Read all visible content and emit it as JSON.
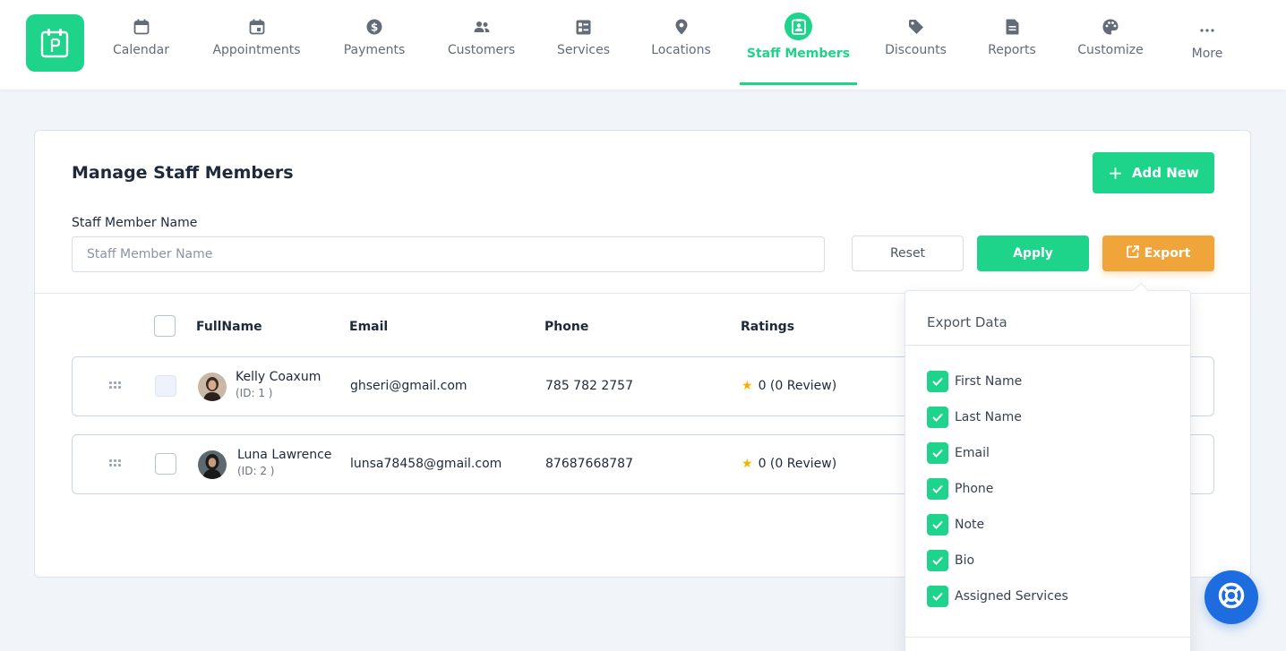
{
  "nav": {
    "logo_icon": "booking-logo-icon",
    "items": [
      {
        "label": "Calendar",
        "icon": "calendar-icon"
      },
      {
        "label": "Appointments",
        "icon": "appointment-icon"
      },
      {
        "label": "Payments",
        "icon": "dollar-icon"
      },
      {
        "label": "Customers",
        "icon": "users-icon"
      },
      {
        "label": "Services",
        "icon": "services-icon"
      },
      {
        "label": "Locations",
        "icon": "location-pin-icon"
      },
      {
        "label": "Staff Members",
        "icon": "staff-badge-icon",
        "active": true
      },
      {
        "label": "Discounts",
        "icon": "tag-icon"
      },
      {
        "label": "Reports",
        "icon": "report-icon"
      },
      {
        "label": "Customize",
        "icon": "palette-icon"
      },
      {
        "label": "More",
        "icon": "more-dots-icon"
      }
    ]
  },
  "page": {
    "title": "Manage Staff Members",
    "add_new_label": "Add New",
    "filter_label": "Staff Member Name",
    "filter_placeholder": "Staff Member Name",
    "filter_value": "",
    "reset_label": "Reset",
    "apply_label": "Apply",
    "export_label": "Export"
  },
  "table": {
    "headers": {
      "fullname": "FullName",
      "email": "Email",
      "phone": "Phone",
      "ratings": "Ratings"
    },
    "rows": [
      {
        "name": "Kelly Coaxum",
        "id": "(ID: 1 )",
        "email": "ghseri@gmail.com",
        "phone": "785 782 2757",
        "rating": "0 (0 Review)"
      },
      {
        "name": "Luna Lawrence",
        "id": "(ID: 2 )",
        "email": "lunsa78458@gmail.com",
        "phone": "87687668787",
        "rating": "0 (0 Review)"
      }
    ]
  },
  "export_menu": {
    "title": "Export Data",
    "options": [
      {
        "label": "First Name",
        "checked": true
      },
      {
        "label": "Last Name",
        "checked": true
      },
      {
        "label": "Email",
        "checked": true
      },
      {
        "label": "Phone",
        "checked": true
      },
      {
        "label": "Note",
        "checked": true
      },
      {
        "label": "Bio",
        "checked": true
      },
      {
        "label": "Assigned Services",
        "checked": true
      }
    ]
  },
  "colors": {
    "accent": "#1ed48a",
    "export": "#f0a53a",
    "help": "#1d6ce0",
    "star": "#f5b301"
  }
}
